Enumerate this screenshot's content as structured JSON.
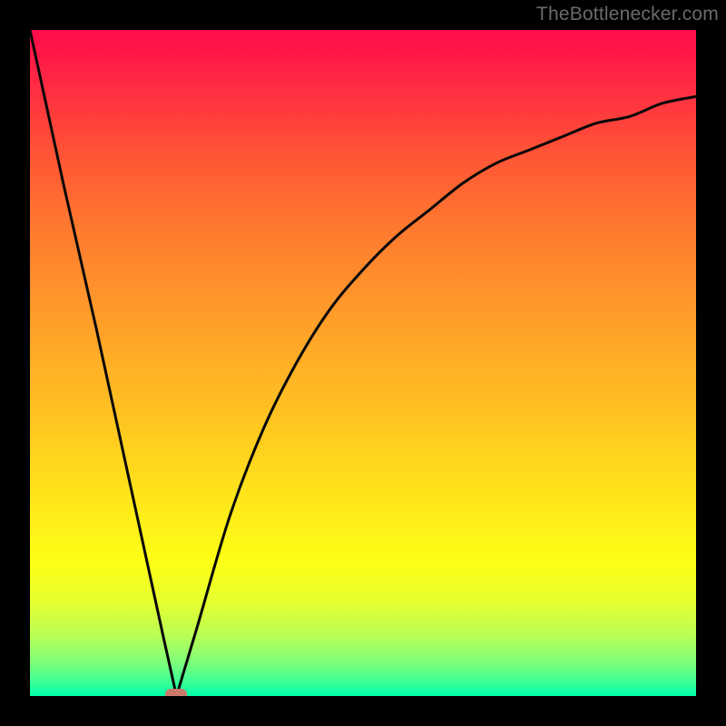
{
  "watermark": "TheBottlenecker.com",
  "colors": {
    "frame": "#000000",
    "curve": "#080808",
    "marker": "#c97a6a"
  },
  "chart_data": {
    "type": "line",
    "title": "",
    "xlabel": "",
    "ylabel": "",
    "xlim": [
      0,
      100
    ],
    "ylim": [
      0,
      100
    ],
    "grid": false,
    "legend": false,
    "description": "V-shaped bottleneck curve: rapid linear drop from top-left to a minimum near x≈22, then an asymptotic rise toward ~90 at the right edge. No axis ticks or labels are shown.",
    "series": [
      {
        "name": "curve",
        "x": [
          0,
          5,
          10,
          15,
          20,
          22,
          25,
          30,
          35,
          40,
          45,
          50,
          55,
          60,
          65,
          70,
          75,
          80,
          85,
          90,
          95,
          100
        ],
        "y": [
          100,
          77,
          55,
          32,
          9,
          0,
          10,
          27,
          40,
          50,
          58,
          64,
          69,
          73,
          77,
          80,
          82,
          84,
          86,
          87,
          89,
          90
        ]
      }
    ],
    "marker": {
      "x": 22,
      "y": 0
    },
    "gradient_stops": [
      {
        "pos": 0,
        "color": "#ff0b4a"
      },
      {
        "pos": 45,
        "color": "#ffa229"
      },
      {
        "pos": 80,
        "color": "#fdff16"
      },
      {
        "pos": 100,
        "color": "#00ffaa"
      }
    ]
  }
}
